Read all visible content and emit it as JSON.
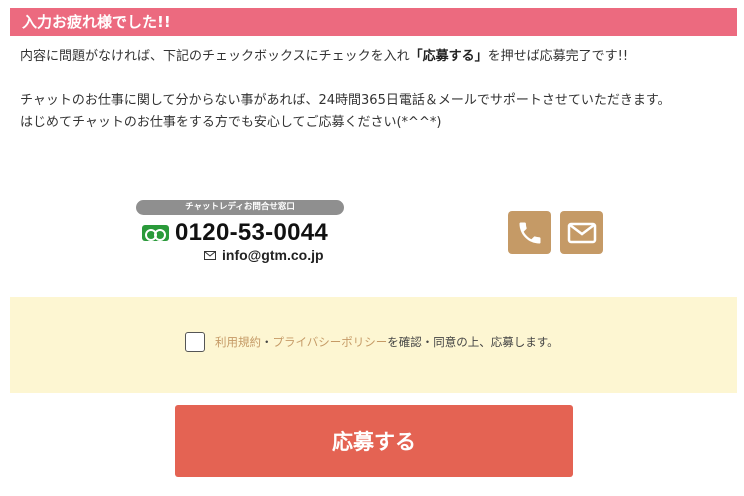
{
  "header": {
    "title": "入力お疲れ様でした!!"
  },
  "intro": {
    "line1_pre": "内容に問題がなければ、下記のチェックボックスにチェックを入れ",
    "line1_bold": "「応募する」",
    "line1_post": "を押せば応募完了です!!",
    "line2": "チャットのお仕事に関して分からない事があれば、24時間365日電話＆メールでサポートさせていただきます。",
    "line3": "はじめてチャットのお仕事をする方でも安心してご応募ください(*^^*)"
  },
  "contact": {
    "badge": "チャットレディお問合せ窓口",
    "phone": "0120-53-0044",
    "email": "info@gtm.co.jp"
  },
  "agreement": {
    "link_terms": "利用規約",
    "separator": "・",
    "link_privacy": "プライバシーポリシー",
    "text_after": "を確認・同意の上、応募します。"
  },
  "submit": {
    "label": "応募する"
  },
  "colors": {
    "header_bg": "#ec6a7f",
    "icon_button": "#c59a66",
    "agree_panel": "#fdf6d2",
    "submit": "#e46353"
  },
  "icons": [
    "freedial-icon",
    "mail-small-icon",
    "phone-icon",
    "mail-icon"
  ]
}
